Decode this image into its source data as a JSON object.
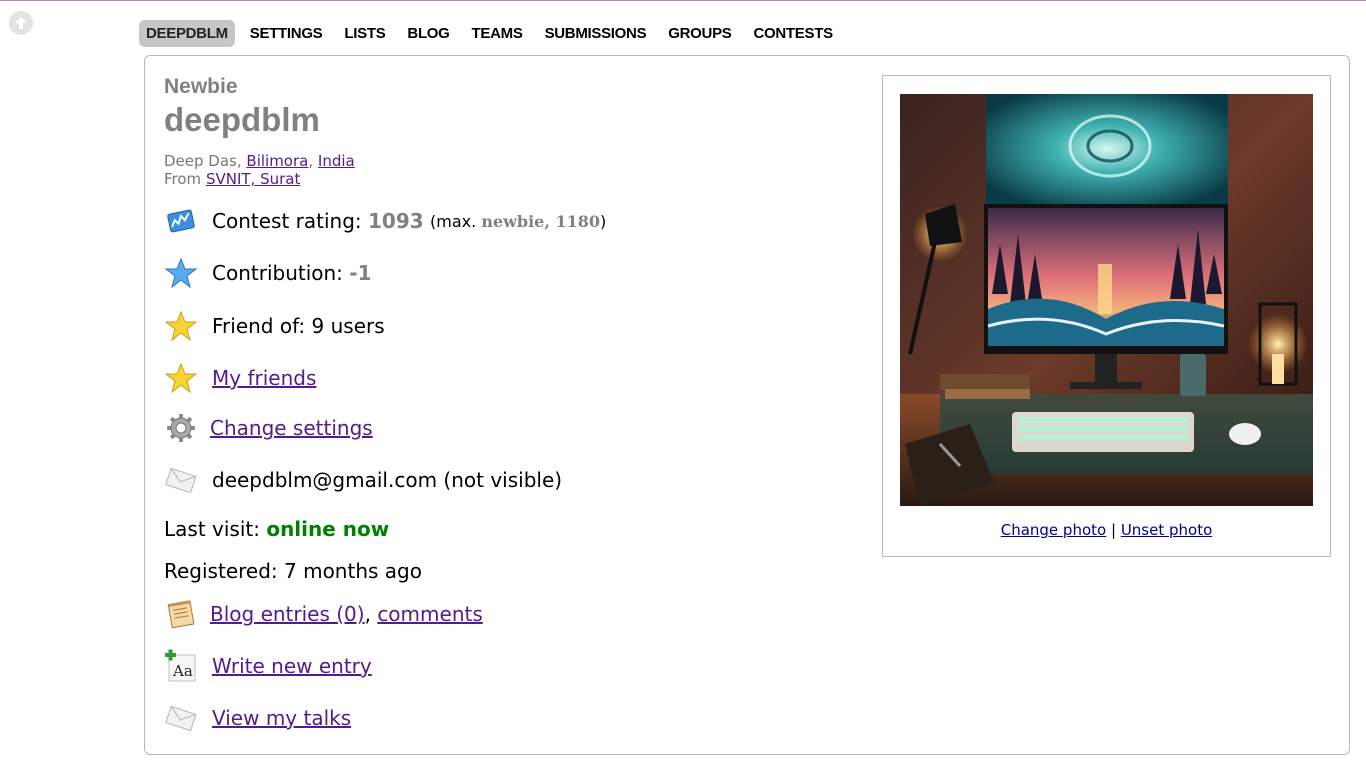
{
  "nav": {
    "items": [
      "DEEPDBLM",
      "SETTINGS",
      "LISTS",
      "BLOG",
      "TEAMS",
      "SUBMISSIONS",
      "GROUPS",
      "CONTESTS"
    ]
  },
  "profile": {
    "rank": "Newbie",
    "handle": "deepdblm",
    "name": "Deep Das",
    "city": "Bilimora",
    "country": "India",
    "from_label": "From",
    "organization": "SVNIT, Surat",
    "rating_label": "Contest rating:",
    "rating_value": "1093",
    "rating_max_prefix": "(max.",
    "rating_max_rank": "newbie, 1180",
    "rating_max_suffix": ")",
    "contribution_label": "Contribution:",
    "contribution_value": "-1",
    "friend_of": "Friend of: 9 users",
    "my_friends": "My friends",
    "change_settings": "Change settings",
    "email": "deepdblm@gmail.com (not visible)",
    "last_visit_label": "Last visit:",
    "last_visit_value": "online now",
    "registered": "Registered: 7 months ago",
    "blog_entries": "Blog entries (0)",
    "comments": "comments",
    "write_entry": "Write new entry",
    "view_talks": "View my talks"
  },
  "photo": {
    "change": "Change photo",
    "separator": "|",
    "unset": "Unset photo"
  },
  "colors": {
    "rank_gray": "#808080",
    "link": "#551a8b",
    "online": "#008000",
    "nav_active_bg": "#c6c6c6"
  }
}
